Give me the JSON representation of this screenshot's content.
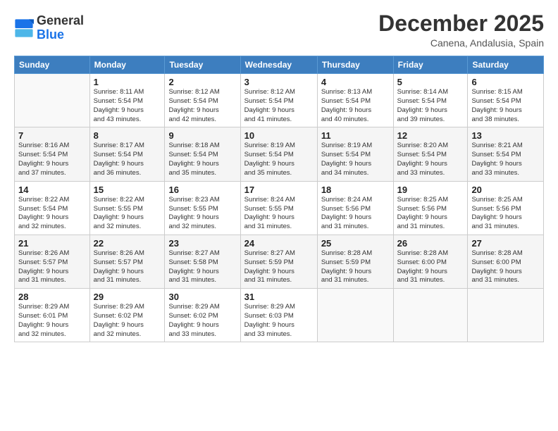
{
  "header": {
    "logo_general": "General",
    "logo_blue": "Blue",
    "month_title": "December 2025",
    "location": "Canena, Andalusia, Spain"
  },
  "days_of_week": [
    "Sunday",
    "Monday",
    "Tuesday",
    "Wednesday",
    "Thursday",
    "Friday",
    "Saturday"
  ],
  "weeks": [
    [
      {
        "day": "",
        "info": ""
      },
      {
        "day": "1",
        "info": "Sunrise: 8:11 AM\nSunset: 5:54 PM\nDaylight: 9 hours\nand 43 minutes."
      },
      {
        "day": "2",
        "info": "Sunrise: 8:12 AM\nSunset: 5:54 PM\nDaylight: 9 hours\nand 42 minutes."
      },
      {
        "day": "3",
        "info": "Sunrise: 8:12 AM\nSunset: 5:54 PM\nDaylight: 9 hours\nand 41 minutes."
      },
      {
        "day": "4",
        "info": "Sunrise: 8:13 AM\nSunset: 5:54 PM\nDaylight: 9 hours\nand 40 minutes."
      },
      {
        "day": "5",
        "info": "Sunrise: 8:14 AM\nSunset: 5:54 PM\nDaylight: 9 hours\nand 39 minutes."
      },
      {
        "day": "6",
        "info": "Sunrise: 8:15 AM\nSunset: 5:54 PM\nDaylight: 9 hours\nand 38 minutes."
      }
    ],
    [
      {
        "day": "7",
        "info": "Sunrise: 8:16 AM\nSunset: 5:54 PM\nDaylight: 9 hours\nand 37 minutes."
      },
      {
        "day": "8",
        "info": "Sunrise: 8:17 AM\nSunset: 5:54 PM\nDaylight: 9 hours\nand 36 minutes."
      },
      {
        "day": "9",
        "info": "Sunrise: 8:18 AM\nSunset: 5:54 PM\nDaylight: 9 hours\nand 35 minutes."
      },
      {
        "day": "10",
        "info": "Sunrise: 8:19 AM\nSunset: 5:54 PM\nDaylight: 9 hours\nand 35 minutes."
      },
      {
        "day": "11",
        "info": "Sunrise: 8:19 AM\nSunset: 5:54 PM\nDaylight: 9 hours\nand 34 minutes."
      },
      {
        "day": "12",
        "info": "Sunrise: 8:20 AM\nSunset: 5:54 PM\nDaylight: 9 hours\nand 33 minutes."
      },
      {
        "day": "13",
        "info": "Sunrise: 8:21 AM\nSunset: 5:54 PM\nDaylight: 9 hours\nand 33 minutes."
      }
    ],
    [
      {
        "day": "14",
        "info": "Sunrise: 8:22 AM\nSunset: 5:54 PM\nDaylight: 9 hours\nand 32 minutes."
      },
      {
        "day": "15",
        "info": "Sunrise: 8:22 AM\nSunset: 5:55 PM\nDaylight: 9 hours\nand 32 minutes."
      },
      {
        "day": "16",
        "info": "Sunrise: 8:23 AM\nSunset: 5:55 PM\nDaylight: 9 hours\nand 32 minutes."
      },
      {
        "day": "17",
        "info": "Sunrise: 8:24 AM\nSunset: 5:55 PM\nDaylight: 9 hours\nand 31 minutes."
      },
      {
        "day": "18",
        "info": "Sunrise: 8:24 AM\nSunset: 5:56 PM\nDaylight: 9 hours\nand 31 minutes."
      },
      {
        "day": "19",
        "info": "Sunrise: 8:25 AM\nSunset: 5:56 PM\nDaylight: 9 hours\nand 31 minutes."
      },
      {
        "day": "20",
        "info": "Sunrise: 8:25 AM\nSunset: 5:56 PM\nDaylight: 9 hours\nand 31 minutes."
      }
    ],
    [
      {
        "day": "21",
        "info": "Sunrise: 8:26 AM\nSunset: 5:57 PM\nDaylight: 9 hours\nand 31 minutes."
      },
      {
        "day": "22",
        "info": "Sunrise: 8:26 AM\nSunset: 5:57 PM\nDaylight: 9 hours\nand 31 minutes."
      },
      {
        "day": "23",
        "info": "Sunrise: 8:27 AM\nSunset: 5:58 PM\nDaylight: 9 hours\nand 31 minutes."
      },
      {
        "day": "24",
        "info": "Sunrise: 8:27 AM\nSunset: 5:59 PM\nDaylight: 9 hours\nand 31 minutes."
      },
      {
        "day": "25",
        "info": "Sunrise: 8:28 AM\nSunset: 5:59 PM\nDaylight: 9 hours\nand 31 minutes."
      },
      {
        "day": "26",
        "info": "Sunrise: 8:28 AM\nSunset: 6:00 PM\nDaylight: 9 hours\nand 31 minutes."
      },
      {
        "day": "27",
        "info": "Sunrise: 8:28 AM\nSunset: 6:00 PM\nDaylight: 9 hours\nand 31 minutes."
      }
    ],
    [
      {
        "day": "28",
        "info": "Sunrise: 8:29 AM\nSunset: 6:01 PM\nDaylight: 9 hours\nand 32 minutes."
      },
      {
        "day": "29",
        "info": "Sunrise: 8:29 AM\nSunset: 6:02 PM\nDaylight: 9 hours\nand 32 minutes."
      },
      {
        "day": "30",
        "info": "Sunrise: 8:29 AM\nSunset: 6:02 PM\nDaylight: 9 hours\nand 33 minutes."
      },
      {
        "day": "31",
        "info": "Sunrise: 8:29 AM\nSunset: 6:03 PM\nDaylight: 9 hours\nand 33 minutes."
      },
      {
        "day": "",
        "info": ""
      },
      {
        "day": "",
        "info": ""
      },
      {
        "day": "",
        "info": ""
      }
    ]
  ]
}
